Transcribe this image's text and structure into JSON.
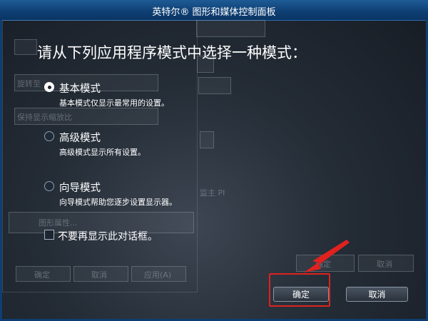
{
  "window": {
    "title": "英特尔® 图形和媒体控制面板"
  },
  "background_ghost": {
    "tab_label": "图形属性...",
    "ok_label": "确定",
    "cancel_label": "取消",
    "apply_label": "应用(A)",
    "apply_label_right": "确定",
    "cancel_label_right": "取消",
    "fragment_1": "旋转至",
    "fragment_2": "保持显示缩放比",
    "fragment_3": "监主 PI"
  },
  "dialog": {
    "heading": "请从下列应用程序模式中选择一种模式：",
    "options": [
      {
        "label": "基本模式",
        "description": "基本模式仅显示最常用的设置。",
        "selected": true
      },
      {
        "label": "高级模式",
        "description": "高级模式显示所有设置。",
        "selected": false
      },
      {
        "label": "向导模式",
        "description": "向导模式帮助您逐步设置显示器。",
        "selected": false
      }
    ],
    "dont_show_again": {
      "label": "不要再显示此对话框。",
      "checked": false
    },
    "ok_button": "确定",
    "cancel_button": "取消"
  },
  "annotation": {
    "highlight_color": "#e0221f"
  }
}
